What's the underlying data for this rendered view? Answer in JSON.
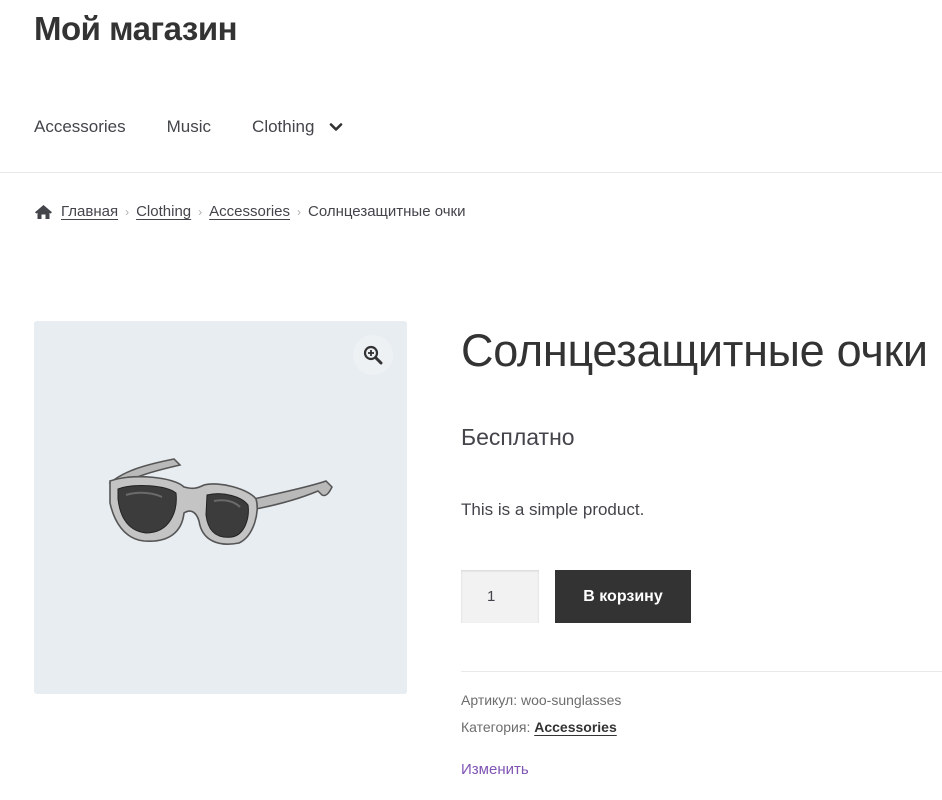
{
  "site": {
    "title": "Мой магазин"
  },
  "nav": {
    "items": [
      {
        "label": "Accessories"
      },
      {
        "label": "Music"
      },
      {
        "label": "Clothing"
      }
    ]
  },
  "breadcrumb": {
    "items": [
      "Главная",
      "Clothing",
      "Accessories"
    ],
    "current": "Солнцезащитные очки"
  },
  "product": {
    "title": "Солнцезащитные очки",
    "price": "Бесплатно",
    "description": "This is a simple product.",
    "quantity": "1",
    "add_to_cart": "В корзину",
    "sku_label": "Артикул:",
    "sku": "woo-sunglasses",
    "category_label": "Категория:",
    "category": "Accessories",
    "edit_label": "Изменить",
    "image_icon": "sunglasses-image"
  },
  "colors": {
    "button_bg": "#333333",
    "gallery_bg": "#e8edf2",
    "edit_link": "#7f54b3"
  }
}
